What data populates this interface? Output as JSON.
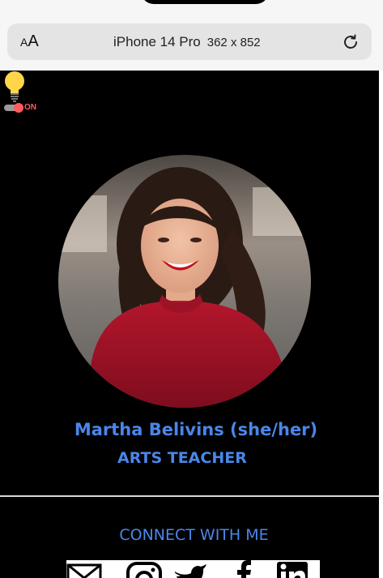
{
  "browser": {
    "text_size_small": "A",
    "text_size_large": "A",
    "device_model": "iPhone 14 Pro",
    "device_dims": "362 x 852"
  },
  "theme_toggle": {
    "label": "ON",
    "state": "on",
    "bulb_color": "#ffd54a",
    "accent": "#ff5b5b"
  },
  "profile": {
    "name": "Martha Belivins (she/her)",
    "title": "ARTS TEACHER"
  },
  "connect": {
    "heading": "CONNECT WITH ME",
    "links": [
      {
        "icon": "mail-icon"
      },
      {
        "icon": "instagram-icon"
      },
      {
        "icon": "twitter-icon"
      },
      {
        "icon": "facebook-icon"
      },
      {
        "icon": "linkedin-icon"
      }
    ]
  },
  "colors": {
    "page_bg": "#000000",
    "accent_blue": "#4a86ea",
    "chrome_bg": "#f6f6f6"
  }
}
